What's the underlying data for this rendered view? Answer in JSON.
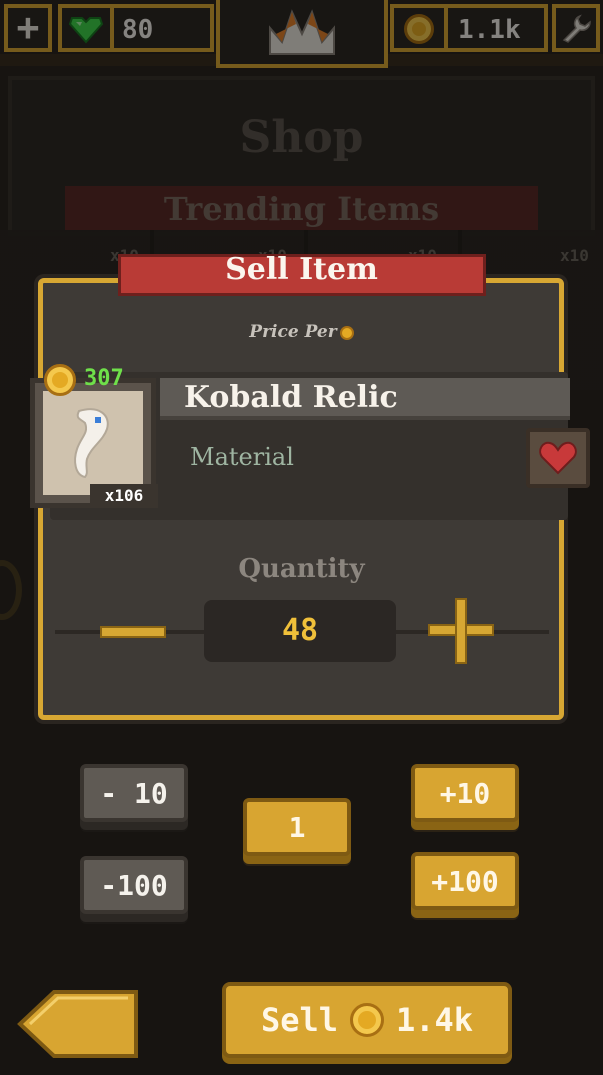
{
  "hud": {
    "gems": "80",
    "coins": "1.1k",
    "icons": {
      "add": "plus-icon",
      "gem": "heart-gem-icon",
      "crown": "crown-icon",
      "coin": "coin-icon",
      "settings": "wrench-icon"
    }
  },
  "background": {
    "shop_title": "Shop",
    "section_title": "Trending Items",
    "stack_labels": [
      "x10",
      "x10",
      "x10",
      "x10"
    ]
  },
  "dialog": {
    "title": "Sell Item",
    "price_label": "Price Per",
    "item": {
      "name": "Kobald Relic",
      "type": "Material",
      "price": "307",
      "owned": "x106",
      "icon": "relic-icon"
    },
    "quantity_label": "Quantity",
    "quantity": "48"
  },
  "steps": {
    "minus10": "- 10",
    "minus100": "-100",
    "one": "1",
    "plus10": "+10",
    "plus100": "+100"
  },
  "sell": {
    "label": "Sell",
    "amount": "1.4k"
  },
  "colors": {
    "gold": "#d7a733",
    "ribbon_red": "#b93b36",
    "price_green": "#6fe04a",
    "quantity_yellow": "#f0c03a"
  }
}
